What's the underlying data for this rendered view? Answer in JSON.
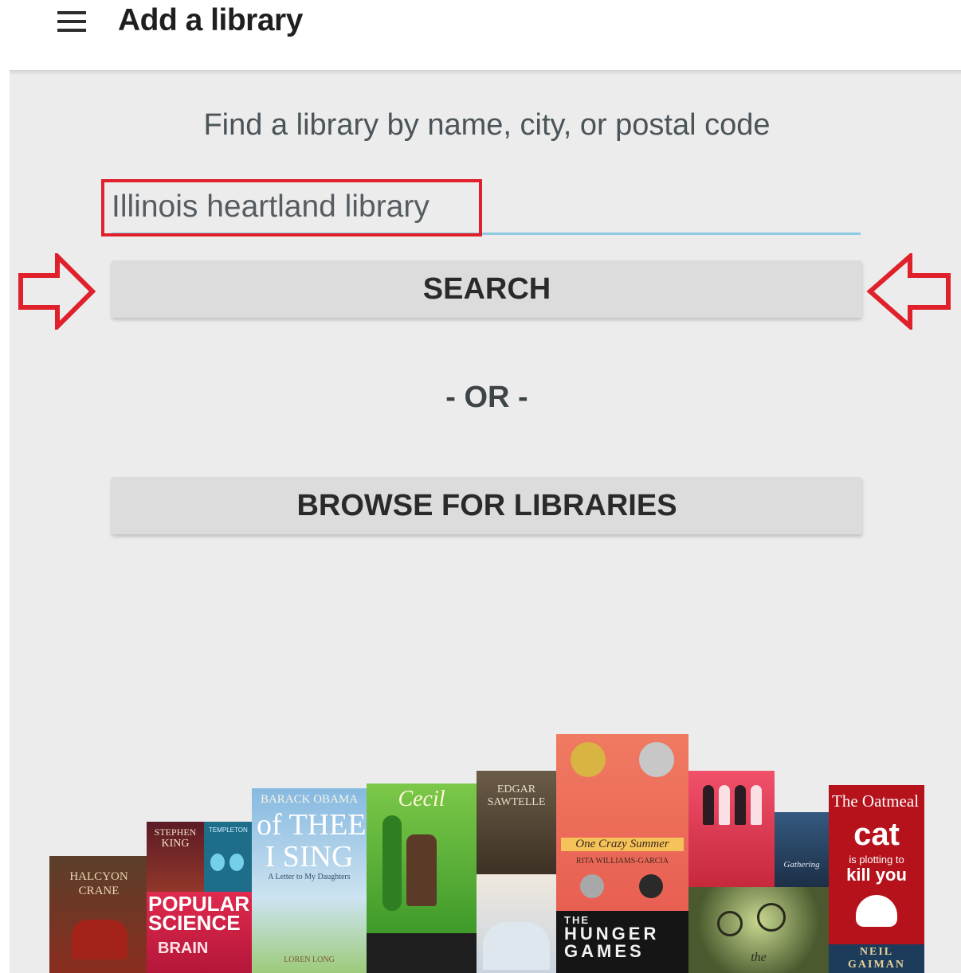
{
  "app_bar": {
    "menu_icon": "menu-icon",
    "title": "Add a library"
  },
  "main": {
    "prompt": "Find a library by name, city, or postal code",
    "search_input": {
      "value": "Illinois heartland library"
    },
    "search_button": "SEARCH",
    "or_label": "- OR -",
    "browse_button": "BROWSE FOR LIBRARIES"
  },
  "annotations": {
    "highlight_color": "#e0202a",
    "arrows": [
      "arrow-right-icon",
      "arrow-left-icon"
    ]
  },
  "books": [
    {
      "id": "halcyon",
      "lines": [
        "HALCYON",
        "CRANE"
      ],
      "color": "#6d4a2a"
    },
    {
      "id": "stephen-king",
      "lines": [
        "STEPHEN",
        "KING"
      ],
      "color": "#7a1f2a"
    },
    {
      "id": "templeton",
      "lines": [
        "TEMPLETON"
      ],
      "color": "#1e6e8a"
    },
    {
      "id": "popular-science",
      "lines": [
        "POPULAR",
        "SCIENCE",
        "BRAIN"
      ],
      "color": "#d8204a"
    },
    {
      "id": "of-thee-i-sing",
      "lines": [
        "BARACK OBAMA",
        "of THEE",
        "I SING",
        "A Letter to My Daughters",
        "LOREN LONG"
      ],
      "color": "#7fb0d8"
    },
    {
      "id": "cecil",
      "lines": [
        "Cecil"
      ],
      "color": "#5fb33a"
    },
    {
      "id": "edgar-sawtelle",
      "lines": [
        "EDGAR",
        "SAWTELLE"
      ],
      "color": "#5a4a36"
    },
    {
      "id": "one-crazy-summer",
      "lines": [
        "One Crazy Summer",
        "RITA WILLIAMS-GARCIA"
      ],
      "color": "#e8766a"
    },
    {
      "id": "hunger-games",
      "lines": [
        "THE",
        "HUNGER",
        "GAMES"
      ],
      "color": "#151515"
    },
    {
      "id": "pink-girls",
      "lines": [
        ""
      ],
      "color": "#e23a58"
    },
    {
      "id": "gathering",
      "lines": [
        "The",
        "Gathering"
      ],
      "color": "#2b4b6e"
    },
    {
      "id": "oatmeal",
      "lines": [
        "The Oatmeal",
        "cat",
        "is plotting to",
        "kill you"
      ],
      "color": "#b5121b"
    },
    {
      "id": "neil-gaiman",
      "lines": [
        "NEIL",
        "GAIMAN"
      ],
      "color": "#1d3b5a"
    },
    {
      "id": "clocks",
      "lines": [
        "the"
      ],
      "color": "#34432a"
    }
  ]
}
